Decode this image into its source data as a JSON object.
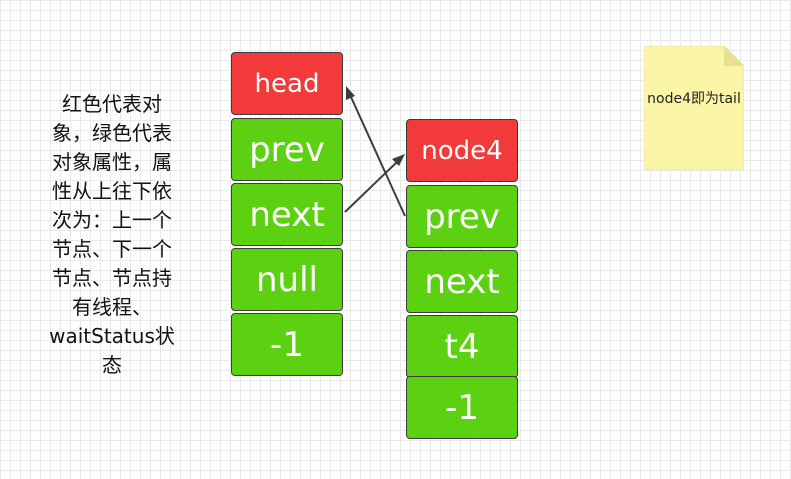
{
  "description": "红色代表对象，绿色代表对象属性，属性从上往下依次为：上一个节点、下一个节点、节点持有线程、waitStatus状态",
  "nodes": {
    "head": {
      "name": "head",
      "fields": [
        "prev",
        "next",
        "null",
        "-1"
      ]
    },
    "node4": {
      "name": "node4",
      "fields": [
        "prev",
        "next",
        "t4",
        "-1"
      ]
    }
  },
  "note": {
    "text": "node4即为tail"
  },
  "colors": {
    "object": "#f23a3a",
    "attribute": "#5cd112",
    "note": "#fbf6a7",
    "border": "#3b3b3b",
    "arrow": "#3d3d3d"
  }
}
